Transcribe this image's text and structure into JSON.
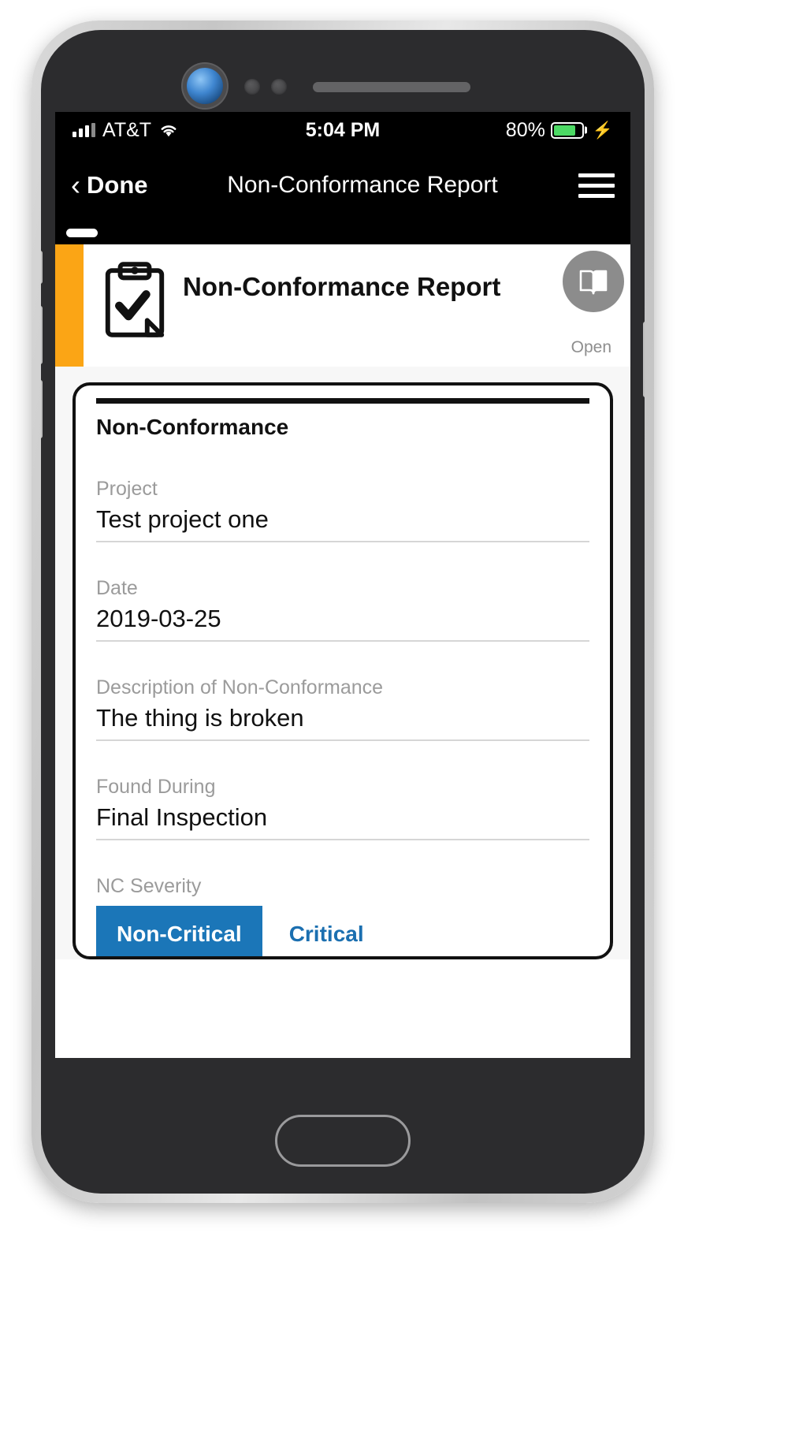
{
  "status_bar": {
    "carrier": "AT&T",
    "time": "5:04 PM",
    "battery_percent": "80%",
    "battery_level": 80,
    "battery_color": "#4cd964",
    "charging_glyph": "⚡",
    "signal_icon": "cellular-signal-icon",
    "wifi_icon": "wifi-icon"
  },
  "nav_bar": {
    "back_label": "Done",
    "back_icon": "chevron-left-icon",
    "title": "Non-Conformance Report",
    "menu_icon": "hamburger-menu-icon"
  },
  "record_header": {
    "icon": "clipboard-check-icon",
    "title": "Non-Conformance Report",
    "status": "Open",
    "accent_color": "#fba515",
    "fab_icon": "book-icon",
    "fab_color": "#8c8c8c"
  },
  "form": {
    "section_heading": "Non-Conformance",
    "fields": [
      {
        "label": "Project",
        "value": "Test project one"
      },
      {
        "label": "Date",
        "value": "2019-03-25"
      },
      {
        "label": "Description of Non-Conformance",
        "value": "The thing is broken"
      },
      {
        "label": "Found During",
        "value": "Final Inspection"
      }
    ],
    "severity": {
      "label": "NC Severity",
      "options": [
        {
          "label": "Non-Critical",
          "selected": true
        },
        {
          "label": "Critical",
          "selected": false
        }
      ],
      "selected_color": "#1b76b8",
      "unselected_text_color": "#1b6fb0"
    }
  }
}
